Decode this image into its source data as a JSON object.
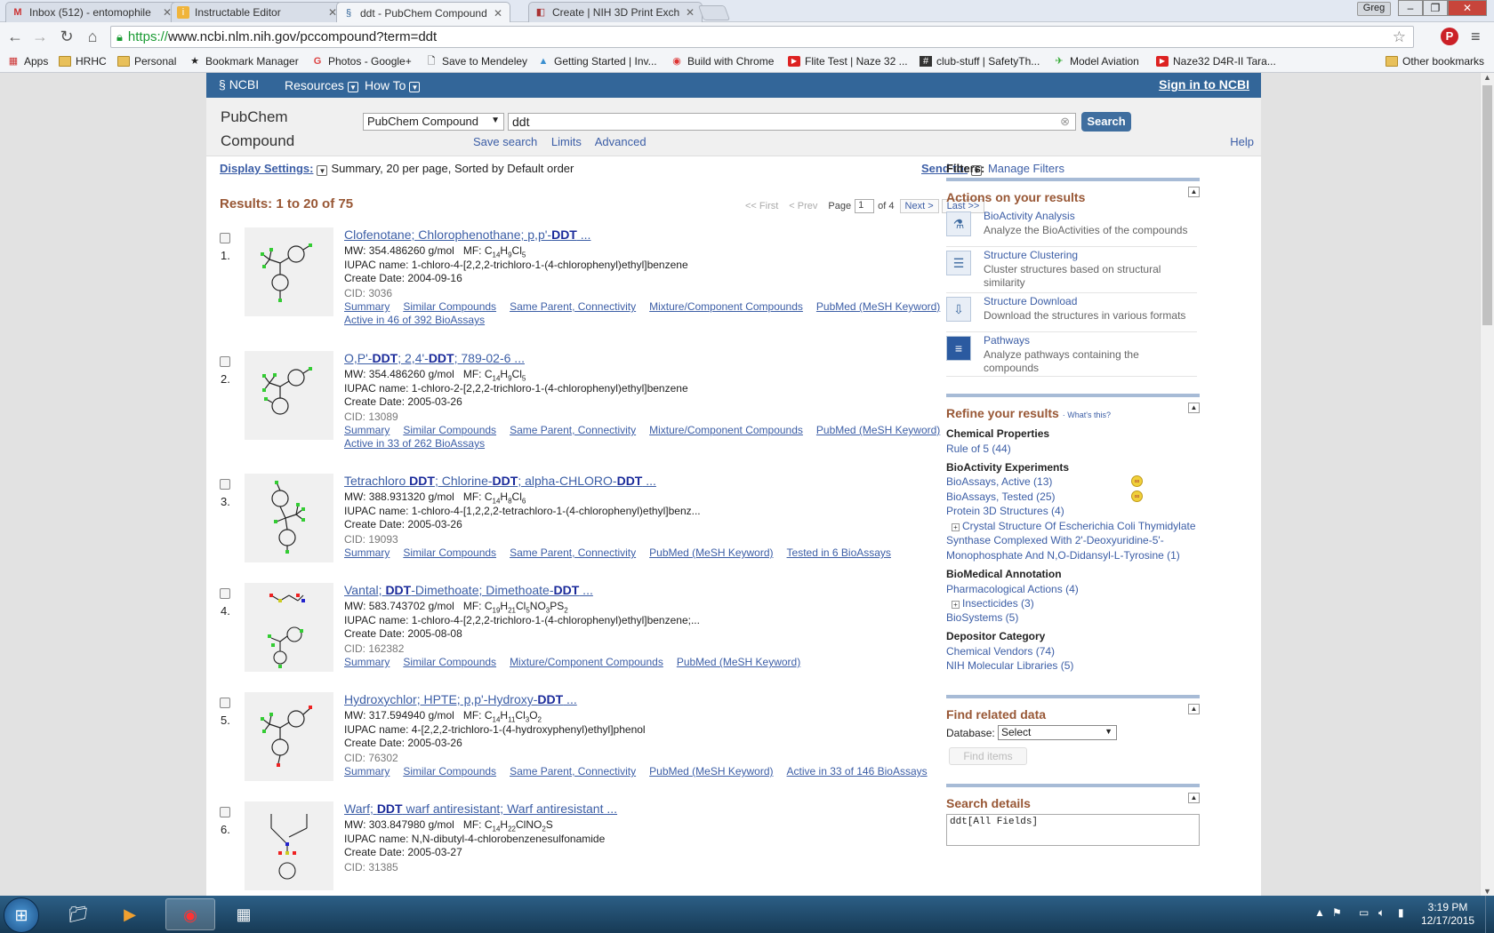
{
  "tabs": [
    {
      "label": "Inbox (512) - entomophile",
      "icon": "M"
    },
    {
      "label": "Instructable Editor",
      "icon": "i"
    },
    {
      "label": "ddt - PubChem Compound",
      "icon": "§"
    },
    {
      "label": "Create | NIH 3D Print Exch",
      "icon": "◧"
    }
  ],
  "window": {
    "user": "Greg"
  },
  "address": {
    "scheme": "https://",
    "rest": "www.ncbi.nlm.nih.gov/pccompound?term=ddt"
  },
  "bookmarks": [
    "Apps",
    "HRHC",
    "Personal",
    "Bookmark Manager",
    "Photos - Google+",
    "Save to Mendeley",
    "Getting Started | Inv...",
    "Build with Chrome",
    "Flite Test | Naze 32 ...",
    "club-stuff | SafetyTh...",
    "Model Aviation",
    "Naze32 D4R-II Tara...",
    "Other bookmarks"
  ],
  "ncbi": {
    "logo": "NCBI",
    "resources": "Resources",
    "howto": "How To",
    "signin": "Sign in to NCBI",
    "db_line1": "PubChem",
    "db_line2": "Compound",
    "db_select": "PubChem Compound",
    "term": "ddt",
    "search": "Search",
    "save_search": "Save search",
    "limits": "Limits",
    "advanced": "Advanced",
    "help": "Help"
  },
  "display": {
    "label": "Display Settings:",
    "summary": "Summary, 20 per page, Sorted by Default order",
    "sendto": "Send to:",
    "results": "Results: 1 to 20 of 75"
  },
  "pager": {
    "first": "<< First",
    "prev": "< Prev",
    "page_label": "Page",
    "page": "1",
    "of": "of 4",
    "next": "Next >",
    "last": "Last >>"
  },
  "results": [
    {
      "num": "1.",
      "title": "Clofenotane; Chlorophenothane; p,p'-DDT ...",
      "mw": "MW: 354.486260 g/mol",
      "mf": "C<sub>14</sub>H<sub>9</sub>Cl<sub>5</sub>",
      "iupac": "IUPAC name: 1-chloro-4-[2,2,2-trichloro-1-(4-chlorophenyl)ethyl]benzene",
      "date": "Create Date: 2004-09-16",
      "cid": "CID: 3036",
      "links": [
        "Summary",
        "Similar Compounds",
        "Same Parent, Connectivity",
        "Mixture/Component Compounds",
        "PubMed (MeSH Keyword)"
      ],
      "extra": "Active in 46 of 392 BioAssays"
    },
    {
      "num": "2.",
      "title": "O,P'-DDT; 2,4'-DDT; 789-02-6 ...",
      "mw": "MW: 354.486260 g/mol",
      "mf": "C<sub>14</sub>H<sub>9</sub>Cl<sub>5</sub>",
      "iupac": "IUPAC name: 1-chloro-2-[2,2,2-trichloro-1-(4-chlorophenyl)ethyl]benzene",
      "date": "Create Date: 2005-03-26",
      "cid": "CID: 13089",
      "links": [
        "Summary",
        "Similar Compounds",
        "Same Parent, Connectivity",
        "Mixture/Component Compounds",
        "PubMed (MeSH Keyword)"
      ],
      "extra": "Active in 33 of 262 BioAssays"
    },
    {
      "num": "3.",
      "title": "Tetrachloro DDT; Chlorine-DDT; alpha-CHLORO-DDT ...",
      "mw": "MW: 388.931320 g/mol",
      "mf": "C<sub>14</sub>H<sub>8</sub>Cl<sub>6</sub>",
      "iupac": "IUPAC name: 1-chloro-4-[1,2,2,2-tetrachloro-1-(4-chlorophenyl)ethyl]benz...",
      "date": "Create Date: 2005-03-26",
      "cid": "CID: 19093",
      "links": [
        "Summary",
        "Similar Compounds",
        "Same Parent, Connectivity",
        "PubMed (MeSH Keyword)",
        "Tested in 6 BioAssays"
      ],
      "extra": ""
    },
    {
      "num": "4.",
      "title": "Vantal; DDT-Dimethoate; Dimethoate-DDT ...",
      "mw": "MW: 583.743702 g/mol",
      "mf": "C<sub>19</sub>H<sub>21</sub>Cl<sub>5</sub>NO<sub>3</sub>PS<sub>2</sub>",
      "iupac": "IUPAC name: 1-chloro-4-[2,2,2-trichloro-1-(4-chlorophenyl)ethyl]benzene;...",
      "date": "Create Date: 2005-08-08",
      "cid": "CID: 162382",
      "links": [
        "Summary",
        "Similar Compounds",
        "Mixture/Component Compounds",
        "PubMed (MeSH Keyword)"
      ],
      "extra": ""
    },
    {
      "num": "5.",
      "title": "Hydroxychlor; HPTE; p,p'-Hydroxy-DDT ...",
      "mw": "MW: 317.594940 g/mol",
      "mf": "C<sub>14</sub>H<sub>11</sub>Cl<sub>3</sub>O<sub>2</sub>",
      "iupac": "IUPAC name: 4-[2,2,2-trichloro-1-(4-hydroxyphenyl)ethyl]phenol",
      "date": "Create Date: 2005-03-26",
      "cid": "CID: 76302",
      "links": [
        "Summary",
        "Similar Compounds",
        "Same Parent, Connectivity",
        "PubMed (MeSH Keyword)",
        "Active in 33 of 146 BioAssays"
      ],
      "extra": ""
    },
    {
      "num": "6.",
      "title": "Warf; DDT warf antiresistant; Warf antiresistant ...",
      "mw": "MW: 303.847980 g/mol",
      "mf": "C<sub>14</sub>H<sub>22</sub>ClNO<sub>2</sub>S",
      "iupac": "IUPAC name: N,N-dibutyl-4-chlorobenzenesulfonamide",
      "date": "Create Date: 2005-03-27",
      "cid": "CID: 31385",
      "links": [],
      "extra": ""
    }
  ],
  "mf_prefix": "MF: ",
  "sidebar": {
    "filters": "Filters:",
    "manage": "Manage Filters",
    "actions_title": "Actions on your results",
    "actions": [
      {
        "title": "BioActivity Analysis",
        "desc": "Analyze the BioActivities of the compounds"
      },
      {
        "title": "Structure Clustering",
        "desc": "Cluster structures based on structural similarity"
      },
      {
        "title": "Structure Download",
        "desc": "Download the structures in various formats"
      },
      {
        "title": "Pathways",
        "desc": "Analyze pathways containing the compounds"
      }
    ],
    "refine_title": "Refine your results",
    "whats_this": "What's this?",
    "chem_props": "Chemical Properties",
    "rule5": "Rule of 5 (44)",
    "bioact": "BioActivity Experiments",
    "bio_active": "BioAssays, Active (13)",
    "bio_tested": "BioAssays, Tested (25)",
    "protein": "Protein 3D Structures (4)",
    "crystal1": "Crystal Structure Of Escherichia Coli Thymidylate",
    "crystal2": "Synthase Complexed With 2'-Deoxyuridine-5'-",
    "crystal3": "Monophosphate And N,O-Didansyl-L-Tyrosine (1)",
    "biomed": "BioMedical Annotation",
    "pharm": "Pharmacological Actions (4)",
    "insect": "Insecticides (3)",
    "biosys": "BioSystems (5)",
    "depositor": "Depositor Category",
    "vendors": "Chemical Vendors (74)",
    "nihml": "NIH Molecular Libraries (5)",
    "related_title": "Find related data",
    "database_label": "Database:",
    "database_select": "Select",
    "find_items": "Find items",
    "details_title": "Search details",
    "details_text": "ddt[All Fields]"
  },
  "taskbar": {
    "time": "3:19 PM",
    "date": "12/17/2015"
  }
}
